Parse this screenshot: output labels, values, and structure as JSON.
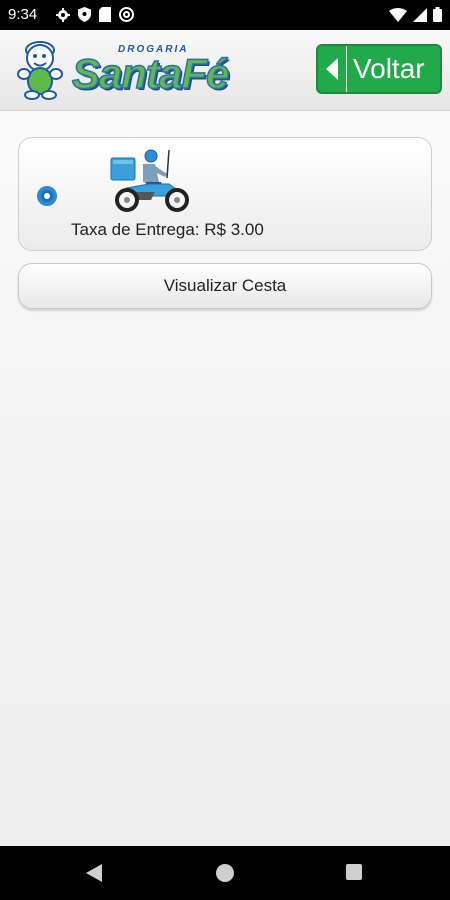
{
  "status_bar": {
    "time": "9:34",
    "left_icons": [
      "gear-icon",
      "shield-icon",
      "sd-card-icon",
      "at-sign-icon"
    ],
    "right_icons": [
      "wifi-icon",
      "signal-icon",
      "battery-icon"
    ]
  },
  "header": {
    "brand_small": "DROGARIA",
    "brand_name": "SantaFé",
    "back_button_label": "Voltar"
  },
  "delivery_option": {
    "icon": "motorcycle-courier-icon",
    "fee_label": "Taxa de Entrega: R$ 3.00",
    "selected": true
  },
  "cart_button_label": "Visualizar Cesta",
  "colors": {
    "header_button": "#22aa4a",
    "radio": "#1e6fb5",
    "brand_green": "#61b94a",
    "brand_blue": "#1e5aa6"
  }
}
